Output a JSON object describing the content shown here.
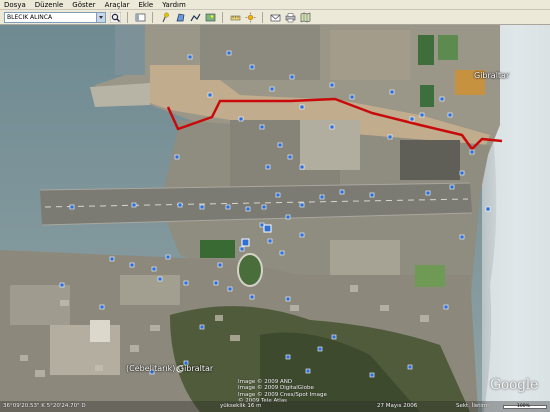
{
  "menu": {
    "items": [
      "Dosya",
      "Düzenle",
      "Göster",
      "Araçlar",
      "Ekle",
      "Yardım"
    ]
  },
  "search": {
    "value": "BLECIK ALINCA"
  },
  "toolbar": {
    "icons": [
      "search-icon",
      "placemark-icon",
      "polygon-icon",
      "path-icon",
      "overlay-icon",
      "ruler-icon",
      "email-icon",
      "print-icon",
      "map-icon"
    ]
  },
  "map": {
    "labels": {
      "gibraltar_top": "Gibraltar",
      "cebelitarik": "(Cebelitarık) Gibraltar"
    },
    "credits": {
      "line1": "Image © 2009 AND",
      "line2": "Image © 2009 DigitalGlobe",
      "line3": "Image © 2009 Cnes/Spot Image",
      "line4": "© 2009 Tele Atlas"
    },
    "logo": "Google",
    "route_color": "#c80a0a"
  },
  "status": {
    "coords": "36°09'20.53\" K   5°20'24.70\" D",
    "streaming": "yükseklik  16 m",
    "date": "27 Mayıs 2006",
    "stream_label": "Sekt. İletimi",
    "progress": "100%"
  }
}
